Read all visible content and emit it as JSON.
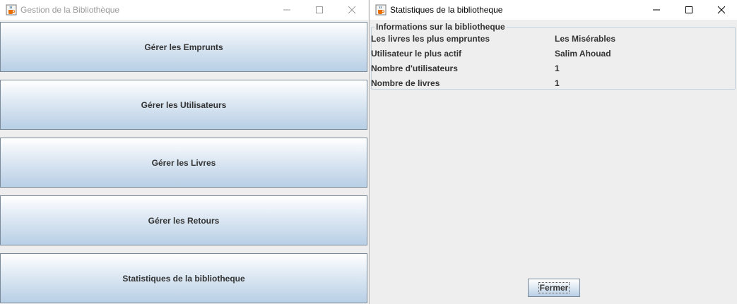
{
  "main_window": {
    "title": "Gestion de la Bibliothèque",
    "buttons": [
      {
        "label": "Gérer les Emprunts"
      },
      {
        "label": "Gérer les Utilisateurs"
      },
      {
        "label": "Gérer les Livres"
      },
      {
        "label": "Gérer les Retours"
      },
      {
        "label": "Statistiques de la bibliotheque"
      }
    ]
  },
  "stats_window": {
    "title": "Statistiques de la bibliotheque",
    "panel_title": "Informations sur la bibliotheque",
    "rows": [
      {
        "label": "Les livres les plus empruntes",
        "value": "Les Misérables"
      },
      {
        "label": "Utilisateur le plus actif",
        "value": "Salim Ahouad"
      },
      {
        "label": "Nombre d'utilisateurs",
        "value": "1"
      },
      {
        "label": "Nombre de livres",
        "value": "1"
      }
    ],
    "close_label": "Fermer"
  },
  "icons": {
    "app": "java-coffee-cup-icon",
    "minimize": "minimize-icon",
    "maximize": "maximize-icon",
    "close": "close-icon"
  },
  "colors": {
    "button_gradient_top": "#ffffff",
    "button_gradient_bottom": "#b8cfe5",
    "button_border": "#7a8a99",
    "window_bg": "#eeeeee",
    "inactive_title": "#9a9a9a"
  }
}
